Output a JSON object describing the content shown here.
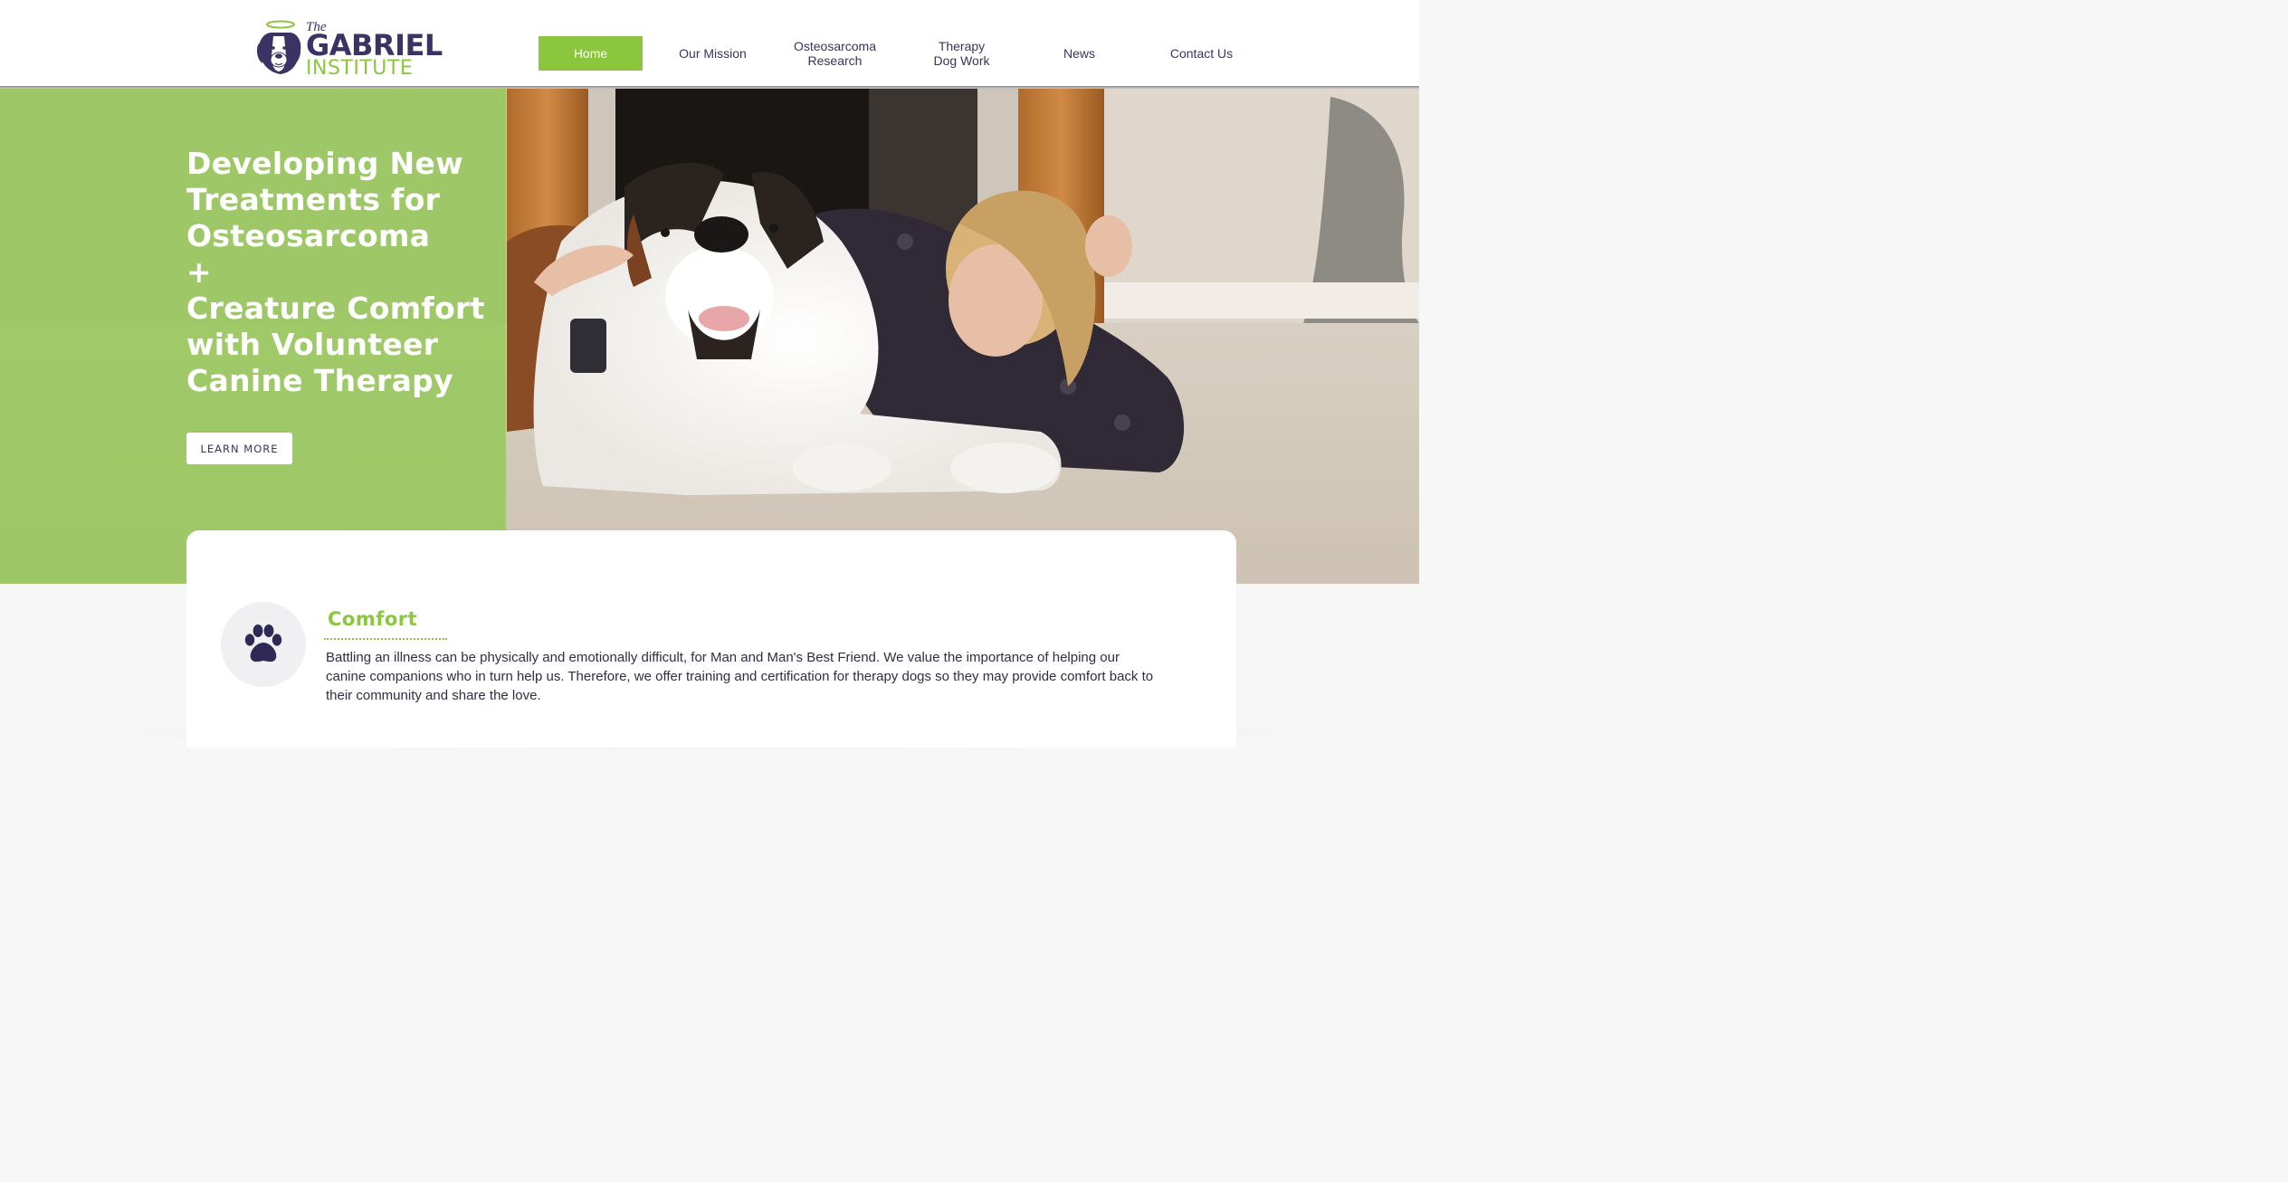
{
  "logo": {
    "the": "The",
    "name": "GABRIEL",
    "sub": "INSTITUTE",
    "icon": "saint-bernard-halo-logo"
  },
  "nav": {
    "items": [
      {
        "label": "Home",
        "active": true
      },
      {
        "label": "Our Mission",
        "active": false
      },
      {
        "label": "Osteosarcoma\nResearch",
        "active": false
      },
      {
        "label": "Therapy\nDog Work",
        "active": false
      },
      {
        "label": "News",
        "active": false
      },
      {
        "label": "Contact Us",
        "active": false
      }
    ]
  },
  "hero": {
    "title": "Developing New\nTreatments for\nOsteosarcoma\n+\nCreature Comfort\nwith Volunteer\nCanine Therapy",
    "button": "LEARN MORE",
    "image": "saint-bernard-dog-and-woman-photo"
  },
  "section": {
    "icon": "paw-icon",
    "title": "Comfort",
    "body": "Battling an illness can be physically and emotionally difficult, for Man and Man's Best Friend. We value the importance of helping our canine companions who in turn help us. Therefore, we offer training and certification for therapy dogs so they may provide comfort back to their community and share the love."
  },
  "colors": {
    "brand_green": "#8cc63f",
    "brand_purple": "#3a3363"
  }
}
